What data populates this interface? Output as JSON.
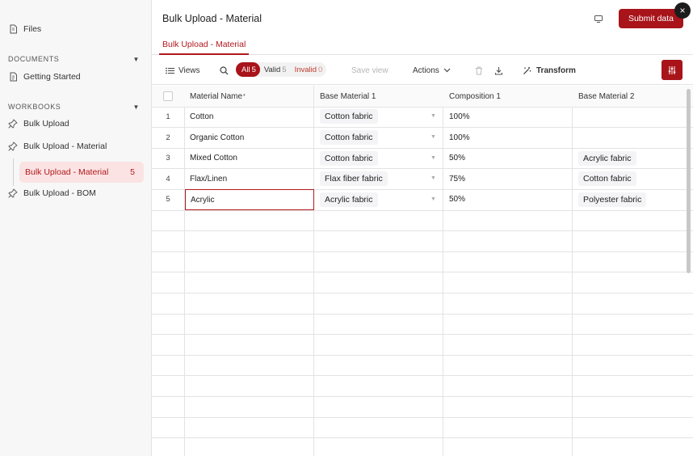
{
  "sidebar": {
    "files_label": "Files",
    "documents_title": "DOCUMENTS",
    "getting_started_label": "Getting Started",
    "workbooks_title": "WORKBOOKS",
    "workbooks": [
      {
        "label": "Bulk Upload"
      },
      {
        "label": "Bulk Upload - Material"
      },
      {
        "label": "Bulk Upload - BOM"
      }
    ],
    "active_sheet": {
      "label": "Bulk Upload - Material",
      "count": "5"
    }
  },
  "header": {
    "title": "Bulk Upload - Material",
    "submit_label": "Submit data",
    "close_icon": "×",
    "tab_label": "Bulk Upload - Material"
  },
  "toolbar": {
    "views_label": "Views",
    "filters": {
      "all_label": "All",
      "all_count": "5",
      "valid_label": "Valid",
      "valid_count": "5",
      "invalid_label": "Invalid",
      "invalid_count": "0"
    },
    "save_view_label": "Save view",
    "actions_label": "Actions",
    "transform_label": "Transform"
  },
  "table": {
    "columns": [
      "Material Name",
      "Base Material 1",
      "Composition 1",
      "Base Material 2"
    ],
    "required_marker": "*",
    "rows": [
      {
        "num": "1",
        "material_name": "Cotton",
        "base_material_1": "Cotton fabric",
        "composition_1": "100%",
        "base_material_2": ""
      },
      {
        "num": "2",
        "material_name": "Organic Cotton",
        "base_material_1": "Cotton fabric",
        "composition_1": "100%",
        "base_material_2": ""
      },
      {
        "num": "3",
        "material_name": "Mixed Cotton",
        "base_material_1": "Cotton fabric",
        "composition_1": "50%",
        "base_material_2": "Acrylic fabric"
      },
      {
        "num": "4",
        "material_name": "Flax/Linen",
        "base_material_1": "Flax fiber fabric",
        "composition_1": "75%",
        "base_material_2": "Cotton fabric"
      },
      {
        "num": "5",
        "material_name": "Acrylic",
        "base_material_1": "Acrylic fabric",
        "composition_1": "50%",
        "base_material_2": "Polyester fabric"
      }
    ]
  },
  "colors": {
    "accent": "#a8141a",
    "active_bg": "#fbe3e3",
    "invalid": "#c0392b"
  },
  "icons": [
    "file-icon",
    "document-icon",
    "pin-icon",
    "list-icon",
    "search-icon",
    "trash-icon",
    "download-icon",
    "magic-wand-icon",
    "monitor-icon",
    "close-icon",
    "filter-settings-icon",
    "caret-down-icon"
  ]
}
